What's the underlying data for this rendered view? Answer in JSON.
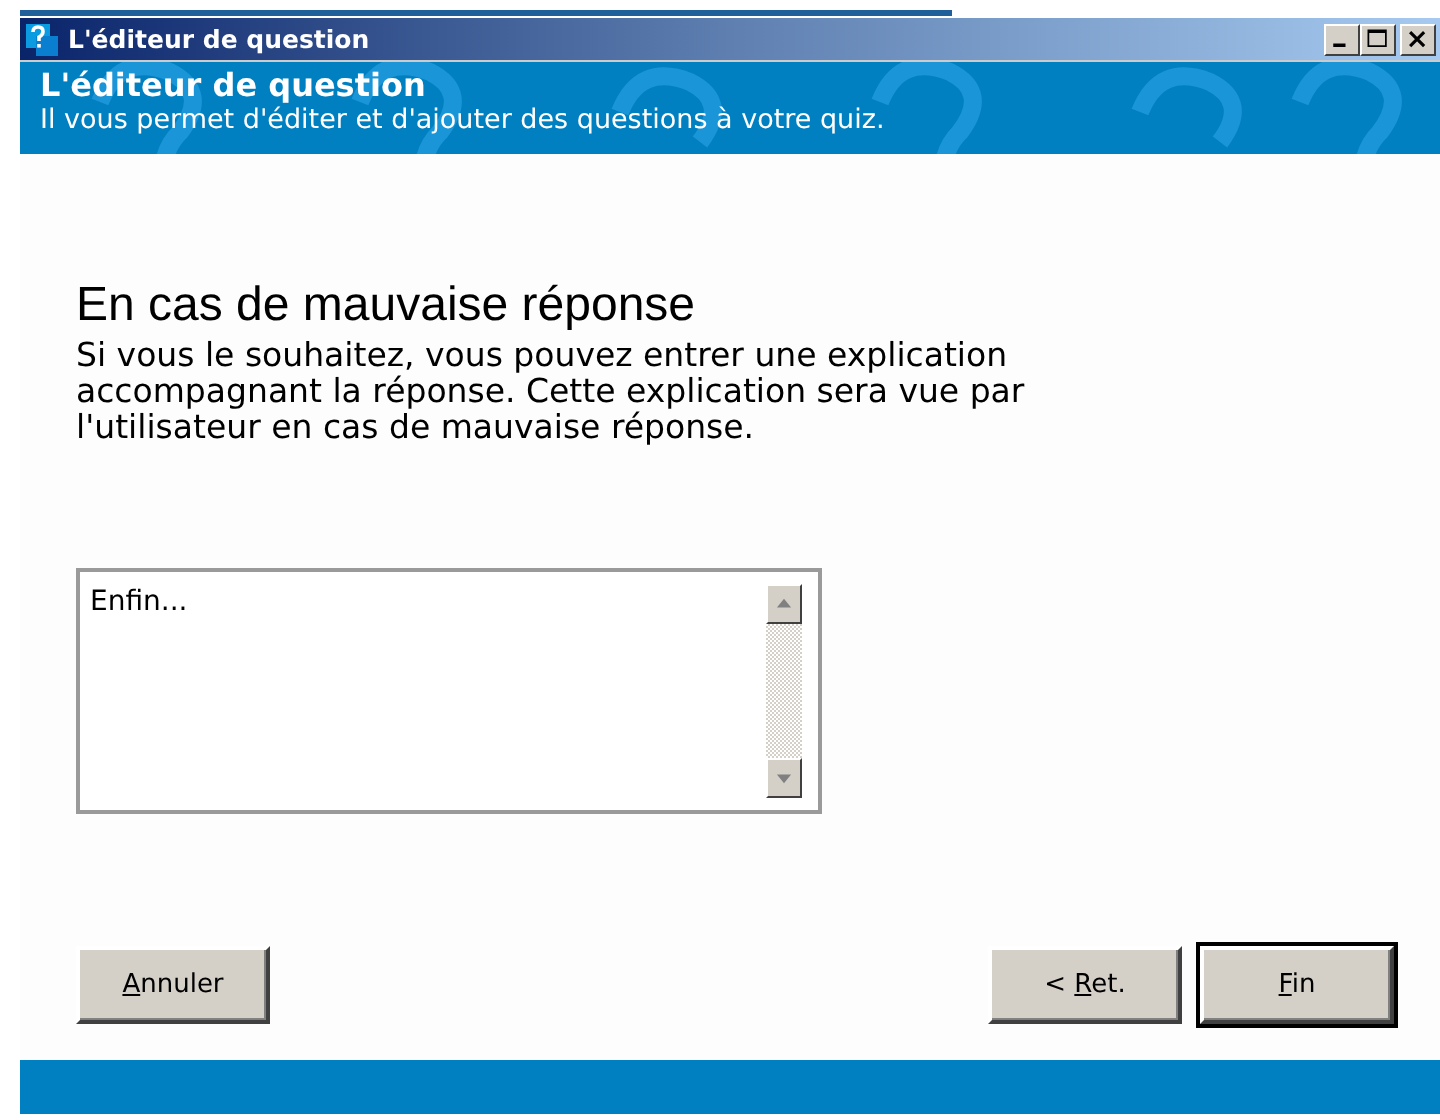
{
  "window": {
    "title": "L'éditeur de question"
  },
  "header": {
    "title": "L'éditeur de question",
    "subtitle": "Il vous permet d'éditer et d'ajouter des questions à votre quiz."
  },
  "step": {
    "heading": "En cas de mauvaise réponse",
    "description": "Si vous le souhaitez, vous pouvez entrer une explication accompagnant la réponse. Cette explication sera vue par l'utilisateur en cas de mauvaise réponse."
  },
  "explanation_field": {
    "value": "Enfin..."
  },
  "buttons": [
    {
      "kind": "cancel",
      "key": "A",
      "after": "nnuler",
      "default": false
    },
    {
      "kind": "back",
      "before": "< ",
      "key": "R",
      "after": "et.",
      "default": false
    },
    {
      "kind": "finish",
      "key": "F",
      "after": "in",
      "default": true
    }
  ]
}
